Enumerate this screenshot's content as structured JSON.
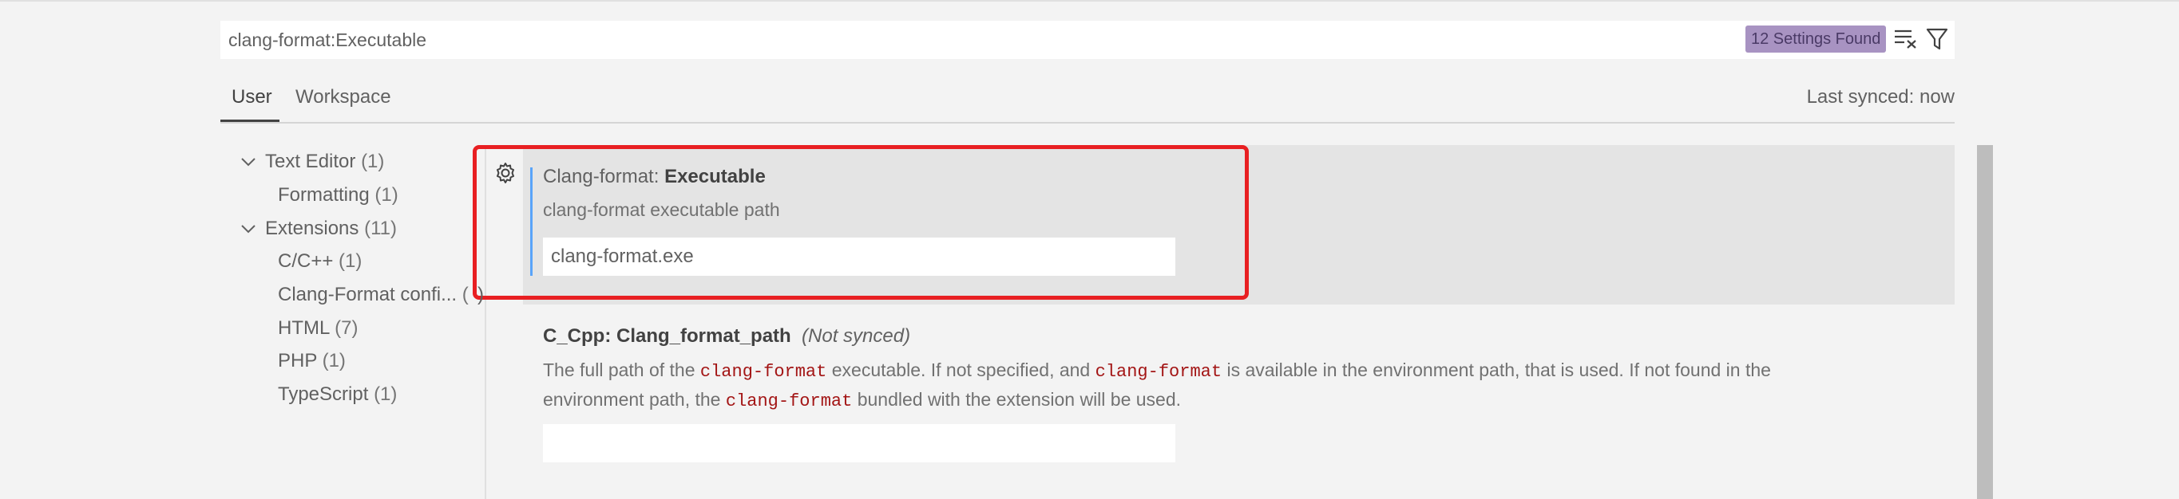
{
  "search": {
    "value": "clang-format:Executable",
    "results_badge": "12 Settings Found",
    "clear_icon": "clear-filter-icon",
    "filter_icon": "filter-icon"
  },
  "tabs": {
    "user": "User",
    "workspace": "Workspace",
    "last_synced": "Last synced: now"
  },
  "toc": [
    {
      "label": "Text Editor",
      "count": "(1)",
      "expanded": true
    },
    {
      "label": "Formatting",
      "count": "(1)"
    },
    {
      "label": "Extensions",
      "count": "(11)",
      "expanded": true
    },
    {
      "label": "C/C++",
      "count": "(1)"
    },
    {
      "label": "Clang-Format confi...",
      "count": "(",
      "count_tail": ")"
    },
    {
      "label": "HTML",
      "count": "(7)"
    },
    {
      "label": "PHP",
      "count": "(1)"
    },
    {
      "label": "TypeScript",
      "count": "(1)"
    }
  ],
  "settings": [
    {
      "category": "Clang-format: ",
      "name": "Executable",
      "description": "clang-format executable path",
      "value": "clang-format.exe"
    },
    {
      "category": "C_Cpp: ",
      "name": "Clang_format_path",
      "note": "(Not synced)",
      "desc_parts": [
        "The full path of the ",
        "clang-format",
        " executable. If not specified, and ",
        "clang-format",
        " is available in the environment path, that is used. If not found in the",
        "environment path, the ",
        "clang-format",
        " bundled with the extension will be used."
      ],
      "value": ""
    }
  ],
  "colors": {
    "highlight": "#e81f22",
    "badge": "#a893c2",
    "modified_indicator": "#59a4f9"
  }
}
